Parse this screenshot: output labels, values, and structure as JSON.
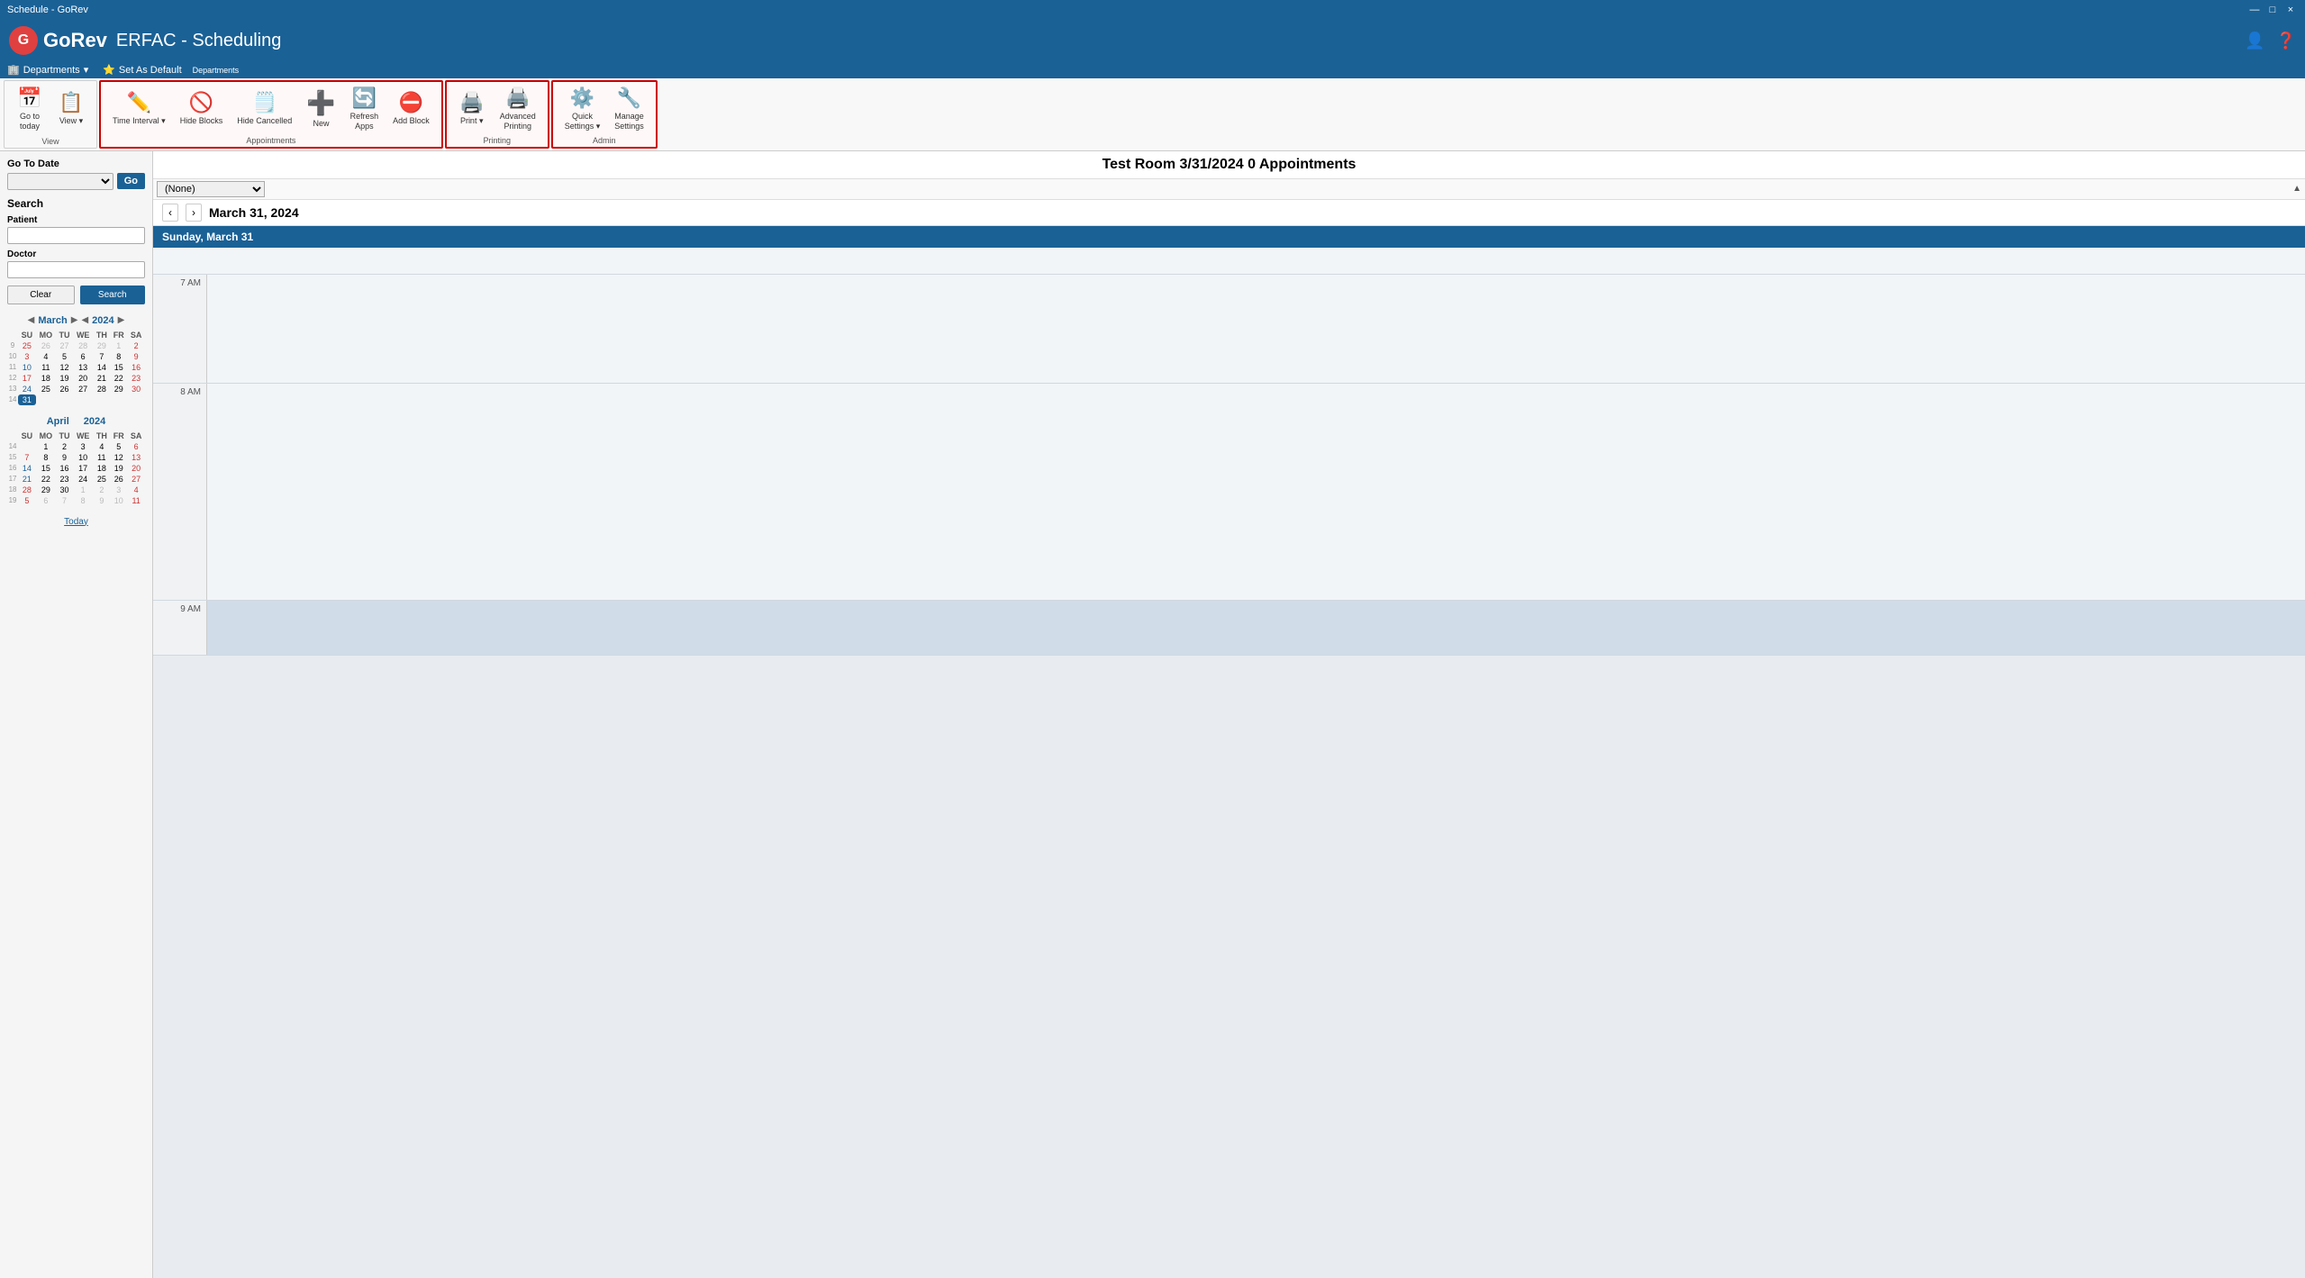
{
  "titleBar": {
    "title": "Schedule - GoRev",
    "controls": [
      "—",
      "□",
      "×"
    ]
  },
  "header": {
    "logoText": "GoRev",
    "appTitle": "ERFAC - Scheduling",
    "icons": [
      "person-icon",
      "help-icon"
    ]
  },
  "departments": {
    "label": "Departments",
    "dropdown_arrow": "▾",
    "set_default": "Set As Default",
    "section_label": "Departments"
  },
  "toolbar": {
    "sections": [
      {
        "id": "view",
        "label": "View",
        "highlighted": false,
        "buttons": [
          {
            "id": "go-to-today",
            "icon": "📅",
            "label": "Go to\ntoday"
          },
          {
            "id": "view",
            "icon": "📋",
            "label": "View",
            "hasDropdown": true
          }
        ]
      },
      {
        "id": "appointments",
        "label": "Appointments",
        "highlighted": true,
        "buttons": [
          {
            "id": "time-interval",
            "icon": "✏️",
            "label": "Time Interval",
            "hasDropdown": true
          },
          {
            "id": "hide-blocks",
            "icon": "🚫",
            "label": "Hide Blocks"
          },
          {
            "id": "hide-cancelled",
            "icon": "🗒️",
            "label": "Hide Cancelled"
          },
          {
            "id": "new",
            "icon": "➕",
            "label": "New"
          },
          {
            "id": "refresh-apps",
            "icon": "🔄",
            "label": "Refresh\nApps"
          },
          {
            "id": "add-block",
            "icon": "🚫",
            "label": "Add Block"
          }
        ]
      },
      {
        "id": "printing",
        "label": "Printing",
        "highlighted": true,
        "buttons": [
          {
            "id": "print",
            "icon": "🖨️",
            "label": "Print",
            "hasDropdown": true
          },
          {
            "id": "advanced-printing",
            "icon": "🖨️",
            "label": "Advanced\nPrinting"
          }
        ]
      },
      {
        "id": "admin",
        "label": "Admin",
        "highlighted": true,
        "buttons": [
          {
            "id": "quick-settings",
            "icon": "⚙️",
            "label": "Quick\nSettings",
            "hasDropdown": true
          },
          {
            "id": "manage-settings",
            "icon": "🔧",
            "label": "Manage\nSettings"
          }
        ]
      }
    ]
  },
  "sidebar": {
    "goToDate": {
      "label": "Go To Date",
      "placeholder": "",
      "goBtn": "Go"
    },
    "search": {
      "label": "Search",
      "patient": {
        "label": "Patient",
        "placeholder": "🔍"
      },
      "doctor": {
        "label": "Doctor",
        "placeholder": "🔍"
      },
      "clearBtn": "Clear",
      "searchBtn": "Search"
    },
    "marchCal": {
      "month": "March",
      "year": "2024",
      "days": [
        "SU",
        "MO",
        "TU",
        "WE",
        "TH",
        "FR",
        "SA"
      ],
      "weeks": [
        {
          "num": "9",
          "days": [
            "25",
            "26",
            "27",
            "28",
            "29",
            "1",
            "2"
          ]
        },
        {
          "num": "10",
          "days": [
            "3",
            "4",
            "5",
            "6",
            "7",
            "8",
            "9"
          ]
        },
        {
          "num": "11",
          "days": [
            "10",
            "11",
            "12",
            "13",
            "14",
            "15",
            "16"
          ]
        },
        {
          "num": "12",
          "days": [
            "17",
            "18",
            "19",
            "20",
            "21",
            "22",
            "23"
          ]
        },
        {
          "num": "13",
          "days": [
            "24",
            "25",
            "26",
            "27",
            "28",
            "29",
            "30"
          ]
        },
        {
          "num": "14",
          "days": [
            "31",
            "",
            "",
            "",
            "",
            "",
            ""
          ]
        }
      ]
    },
    "aprilCal": {
      "month": "April",
      "year": "2024",
      "days": [
        "SU",
        "MO",
        "TU",
        "WE",
        "TH",
        "FR",
        "SA"
      ],
      "weeks": [
        {
          "num": "14",
          "days": [
            "",
            "1",
            "2",
            "3",
            "4",
            "5",
            "6"
          ]
        },
        {
          "num": "15",
          "days": [
            "7",
            "8",
            "9",
            "10",
            "11",
            "12",
            "13"
          ]
        },
        {
          "num": "16",
          "days": [
            "14",
            "15",
            "16",
            "17",
            "18",
            "19",
            "20"
          ]
        },
        {
          "num": "17",
          "days": [
            "21",
            "22",
            "23",
            "24",
            "25",
            "26",
            "27"
          ]
        },
        {
          "num": "18",
          "days": [
            "28",
            "29",
            "30",
            "1",
            "2",
            "3",
            "4"
          ]
        },
        {
          "num": "19",
          "days": [
            "5",
            "6",
            "7",
            "8",
            "9",
            "10",
            "11"
          ]
        }
      ]
    },
    "todayBtn": "Today"
  },
  "mainContent": {
    "title": "Test Room 3/31/2024 0 Appointments",
    "currentDate": "March 31, 2024",
    "dayHeader": "Sunday, March 31",
    "roomSelect": "(None)",
    "timeSlots": [
      "7 AM",
      "8 AM",
      "9 AM"
    ]
  }
}
